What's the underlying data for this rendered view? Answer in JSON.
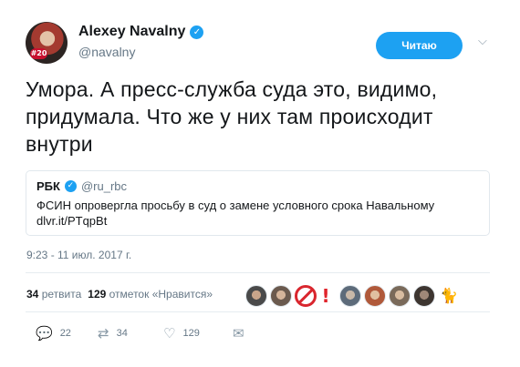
{
  "author": {
    "display_name": "Alexey Navalny",
    "handle": "@navalny",
    "avatar_badge": "#20"
  },
  "follow_button": {
    "label": "Читаю"
  },
  "tweet": {
    "text": "Умора. А пресс-служба суда это, видимо, придумала. Что же у них там происходит внутри"
  },
  "quote": {
    "name": "РБК",
    "handle": "@ru_rbc",
    "text": "ФСИН опровергла просьбу в суд о замене условного срока Навальному",
    "link": "dlvr.it/PTqpBt"
  },
  "timestamp": "9:23 - 11 июл. 2017 г.",
  "stats": {
    "retweets_count": "34",
    "retweets_label": "ретвита",
    "likes_count": "129",
    "likes_label": "отметок «Нравится»"
  },
  "likers": [
    {
      "name": "liker-avatar-1",
      "color": "#4a4a4a"
    },
    {
      "name": "liker-avatar-2",
      "color": "#6b5a4e"
    },
    {
      "name": "liker-avatar-3",
      "color": "#8a7f72"
    },
    {
      "name": "liker-avatar-4",
      "color": "#5d6b7a"
    },
    {
      "name": "liker-avatar-5",
      "color": "#b0593a"
    },
    {
      "name": "liker-avatar-6",
      "color": "#7a6a5a"
    },
    {
      "name": "liker-avatar-7",
      "color": "#3d3530"
    }
  ],
  "actions": {
    "reply_count": "22",
    "retweet_count": "34",
    "like_count": "129"
  },
  "colors": {
    "accent": "#1da1f2",
    "muted": "#657786",
    "border": "#e1e8ed"
  }
}
